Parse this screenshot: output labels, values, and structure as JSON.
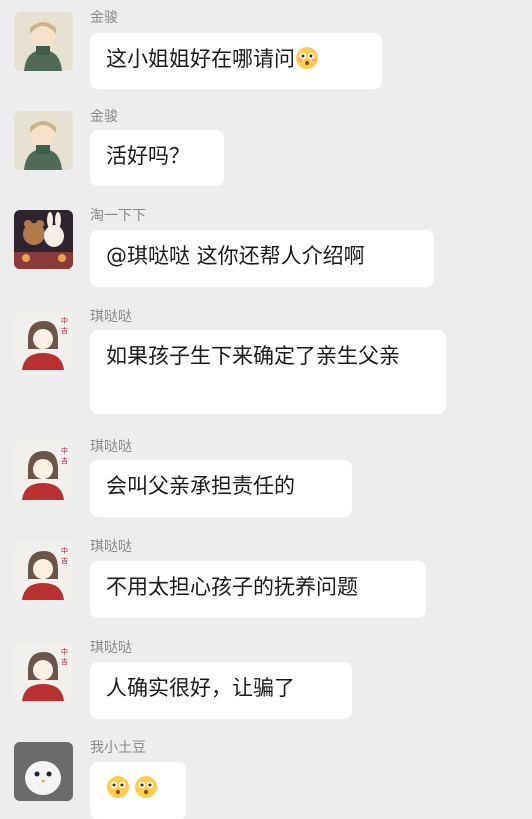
{
  "messages": [
    {
      "sender": "金骏",
      "text": "这小姐姐好在哪请问",
      "emoji": "flushed-face"
    },
    {
      "sender": "金骏",
      "text": "活好吗？"
    },
    {
      "sender": "淘一下下",
      "text": "@琪哒哒 这你还帮人介绍啊"
    },
    {
      "sender": "琪哒哒",
      "text": "如果孩子生下来确定了亲生父亲"
    },
    {
      "sender": "琪哒哒",
      "text": "会叫父亲承担责任的"
    },
    {
      "sender": "琪哒哒",
      "text": "不用太担心孩子的抚养问题"
    },
    {
      "sender": "琪哒哒",
      "text": "人确实很好，让骗了"
    },
    {
      "sender": "我小土豆",
      "emoji": "flushed-face x2"
    }
  ],
  "avatar_icons": [
    "anime-boy-green-scarf",
    "anime-boy-green-scarf",
    "cartoon-bear-rabbit",
    "anime-girl-red-sweater",
    "anime-girl-red-sweater",
    "anime-girl-red-sweater",
    "anime-girl-red-sweater",
    "white-bird"
  ],
  "colors": {
    "background": "#ededed",
    "bubble": "#ffffff",
    "name": "#8a8a8a",
    "text": "#1a1a1a"
  }
}
